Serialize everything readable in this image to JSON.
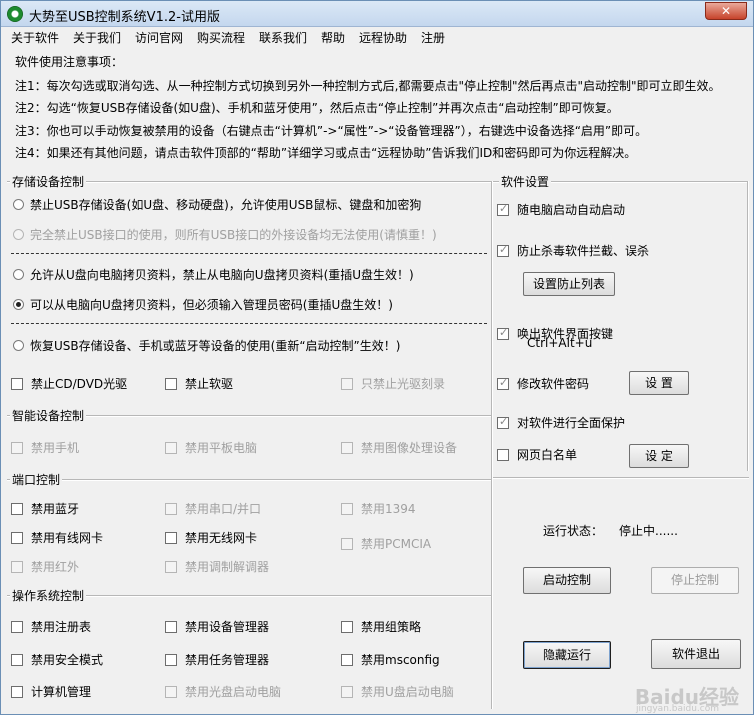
{
  "window": {
    "title": "大势至USB控制系统V1.2-试用版",
    "close_label": "✕"
  },
  "menu": [
    "关于软件",
    "关于我们",
    "访问官网",
    "购买流程",
    "联系我们",
    "帮助",
    "远程协助",
    "注册"
  ],
  "notes": {
    "heading": "软件使用注意事项：",
    "lines": [
      "注1：每次勾选或取消勾选、从一种控制方式切换到另外一种控制方式后,都需要点击\"停止控制\"然后再点击\"启动控制\"即可立即生效。",
      "注2：勾选“恢复USB存储设备(如U盘)、手机和蓝牙使用”，然后点击“停止控制”并再次点击“启动控制”即可恢复。",
      "注3：你也可以手动恢复被禁用的设备（右键点击“计算机”->“属性”->“设备管理器”），右键选中设备选择“启用”即可。",
      "注4：如果还有其他问题，请点击软件顶部的“帮助”详细学习或点击“远程协助”告诉我们ID和密码即可为你远程解决。"
    ]
  },
  "storage": {
    "label": "存储设备控制",
    "options": [
      {
        "text": "禁止USB存储设备(如U盘、移动硬盘)，允许使用USB鼠标、键盘和加密狗",
        "selected": false,
        "disabled": false
      },
      {
        "text": "完全禁止USB接口的使用，则所有USB接口的外接设备均无法使用(请慎重！)",
        "selected": false,
        "disabled": true
      },
      {
        "text": "允许从U盘向电脑拷贝资料，禁止从电脑向U盘拷贝资料(重插U盘生效！)",
        "selected": false,
        "disabled": false
      },
      {
        "text": "可以从电脑向U盘拷贝资料，但必须输入管理员密码(重插U盘生效！)",
        "selected": true,
        "disabled": false
      },
      {
        "text": "恢复USB存储设备、手机或蓝牙等设备的使用(重新“启动控制”生效！)",
        "selected": false,
        "disabled": false
      }
    ],
    "checks": [
      {
        "text": "禁止CD/DVD光驱",
        "checked": false,
        "disabled": false
      },
      {
        "text": "禁止软驱",
        "checked": false,
        "disabled": false
      },
      {
        "text": "只禁止光驱刻录",
        "checked": false,
        "disabled": true
      }
    ]
  },
  "smart": {
    "label": "智能设备控制",
    "checks": [
      {
        "text": "禁用手机",
        "checked": false,
        "disabled": true
      },
      {
        "text": "禁用平板电脑",
        "checked": false,
        "disabled": true
      },
      {
        "text": "禁用图像处理设备",
        "checked": false,
        "disabled": true
      }
    ]
  },
  "ports": {
    "label": "端口控制",
    "checks": [
      {
        "text": "禁用蓝牙",
        "checked": false,
        "disabled": false
      },
      {
        "text": "禁用串口/并口",
        "checked": false,
        "disabled": true
      },
      {
        "text": "禁用1394",
        "checked": false,
        "disabled": true
      },
      {
        "text": "禁用有线网卡",
        "checked": false,
        "disabled": false
      },
      {
        "text": "禁用无线网卡",
        "checked": false,
        "disabled": false
      },
      {
        "text": "禁用PCMCIA",
        "checked": false,
        "disabled": true
      },
      {
        "text": "禁用红外",
        "checked": false,
        "disabled": true
      },
      {
        "text": "禁用调制解调器",
        "checked": false,
        "disabled": true
      }
    ]
  },
  "os": {
    "label": "操作系统控制",
    "checks": [
      {
        "text": "禁用注册表",
        "checked": false,
        "disabled": false
      },
      {
        "text": "禁用设备管理器",
        "checked": false,
        "disabled": false
      },
      {
        "text": "禁用组策略",
        "checked": false,
        "disabled": false
      },
      {
        "text": "禁用安全模式",
        "checked": false,
        "disabled": false
      },
      {
        "text": "禁用任务管理器",
        "checked": false,
        "disabled": false
      },
      {
        "text": "禁用msconfig",
        "checked": false,
        "disabled": false
      },
      {
        "text": "计算机管理",
        "checked": false,
        "disabled": false
      },
      {
        "text": "禁用光盘启动电脑",
        "checked": false,
        "disabled": true
      },
      {
        "text": "禁用U盘启动电脑",
        "checked": false,
        "disabled": true
      }
    ]
  },
  "settings": {
    "label": "软件设置",
    "autostart": "随电脑启动自动启动",
    "antivirus": "防止杀毒软件拦截、误杀",
    "set_list_button": "设置防止列表",
    "hotkey_line1": "唤出软件界面按键",
    "hotkey_line2": "Ctrl+Alt+u",
    "change_password": "修改软件密码",
    "settings_button": "设 置",
    "full_protect": "对软件进行全面保护",
    "whitelist": "网页白名单",
    "whitelist_button": "设 定"
  },
  "run": {
    "status_label": "运行状态：",
    "status_value": "停止中......",
    "start_button": "启动控制",
    "stop_button": "停止控制",
    "hide_button": "隐藏运行",
    "exit_button": "软件退出"
  },
  "watermark": {
    "brand": "Baidu经验",
    "url": "jingyan.baidu.com"
  }
}
